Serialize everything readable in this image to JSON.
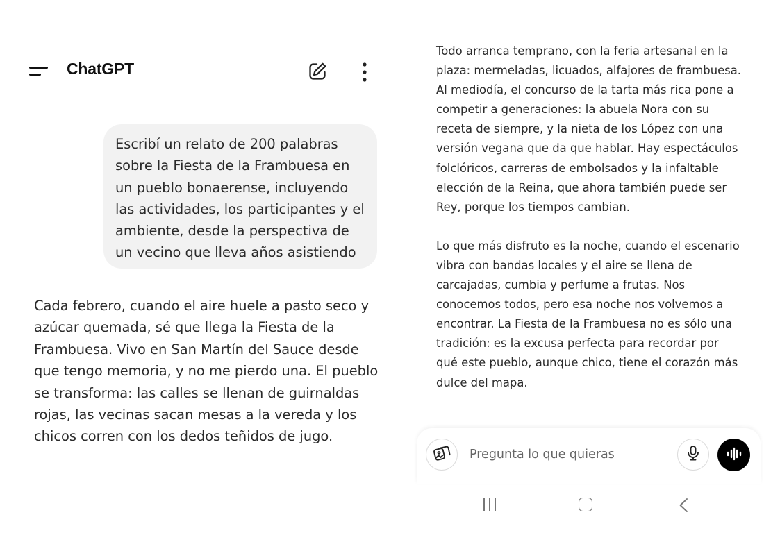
{
  "header": {
    "title": "ChatGPT",
    "menu_icon": "menu-icon",
    "new_chat_icon": "edit-icon",
    "more_icon": "more-vertical-icon"
  },
  "conversation": {
    "user_message": "Escribí un relato de 200 palabras sobre la Fiesta de la Frambuesa en un pueblo bonaerense, incluyendo las actividades, los participantes y el ambiente, desde la perspectiva de un vecino que lleva años asistiendo",
    "assistant_paragraphs": [
      "Cada febrero, cuando el aire huele a pasto seco y azúcar quemada, sé que llega la Fiesta de la Frambuesa. Vivo en San Martín del Sauce desde que tengo memoria, y no me pierdo una. El pueblo se transforma: las calles se llenan de guirnaldas rojas, las vecinas sacan mesas a la vereda y los chicos corren con los dedos teñidos de jugo.",
      "Todo arranca temprano, con la feria artesanal en la plaza: mermeladas, licuados, alfajores de frambuesa. Al mediodía, el concurso de la tarta más rica pone a competir a generaciones: la abuela Nora con su receta de siempre, y la nieta de los López con una versión vegana que da que hablar. Hay espectáculos folclóricos, carreras de embolsados y la infaltable elección de la Reina, que ahora también puede ser Rey, porque los tiempos cambian.",
      "Lo que más disfruto es la noche, cuando el escenario vibra con bandas locales y el aire se llena de carcajadas, cumbia y perfume a frutas. Nos conocemos todos, pero esa noche nos volvemos a encontrar. La Fiesta de la Frambuesa no es sólo una tradición: es la excusa perfecta para recordar por qué este pueblo, aunque chico, tiene el corazón más dulce del mapa."
    ]
  },
  "composer": {
    "placeholder": "Pregunta lo que quieras",
    "attach_icon": "image-attach-icon",
    "mic_icon": "microphone-icon",
    "voice_icon": "voice-mode-icon"
  },
  "system_nav": {
    "recents_icon": "recents-icon",
    "home_icon": "home-icon",
    "back_icon": "back-icon"
  },
  "colors": {
    "background": "#ffffff",
    "user_bubble": "#f2f2f2",
    "text": "#2a2a2a",
    "voice_button": "#000000"
  }
}
